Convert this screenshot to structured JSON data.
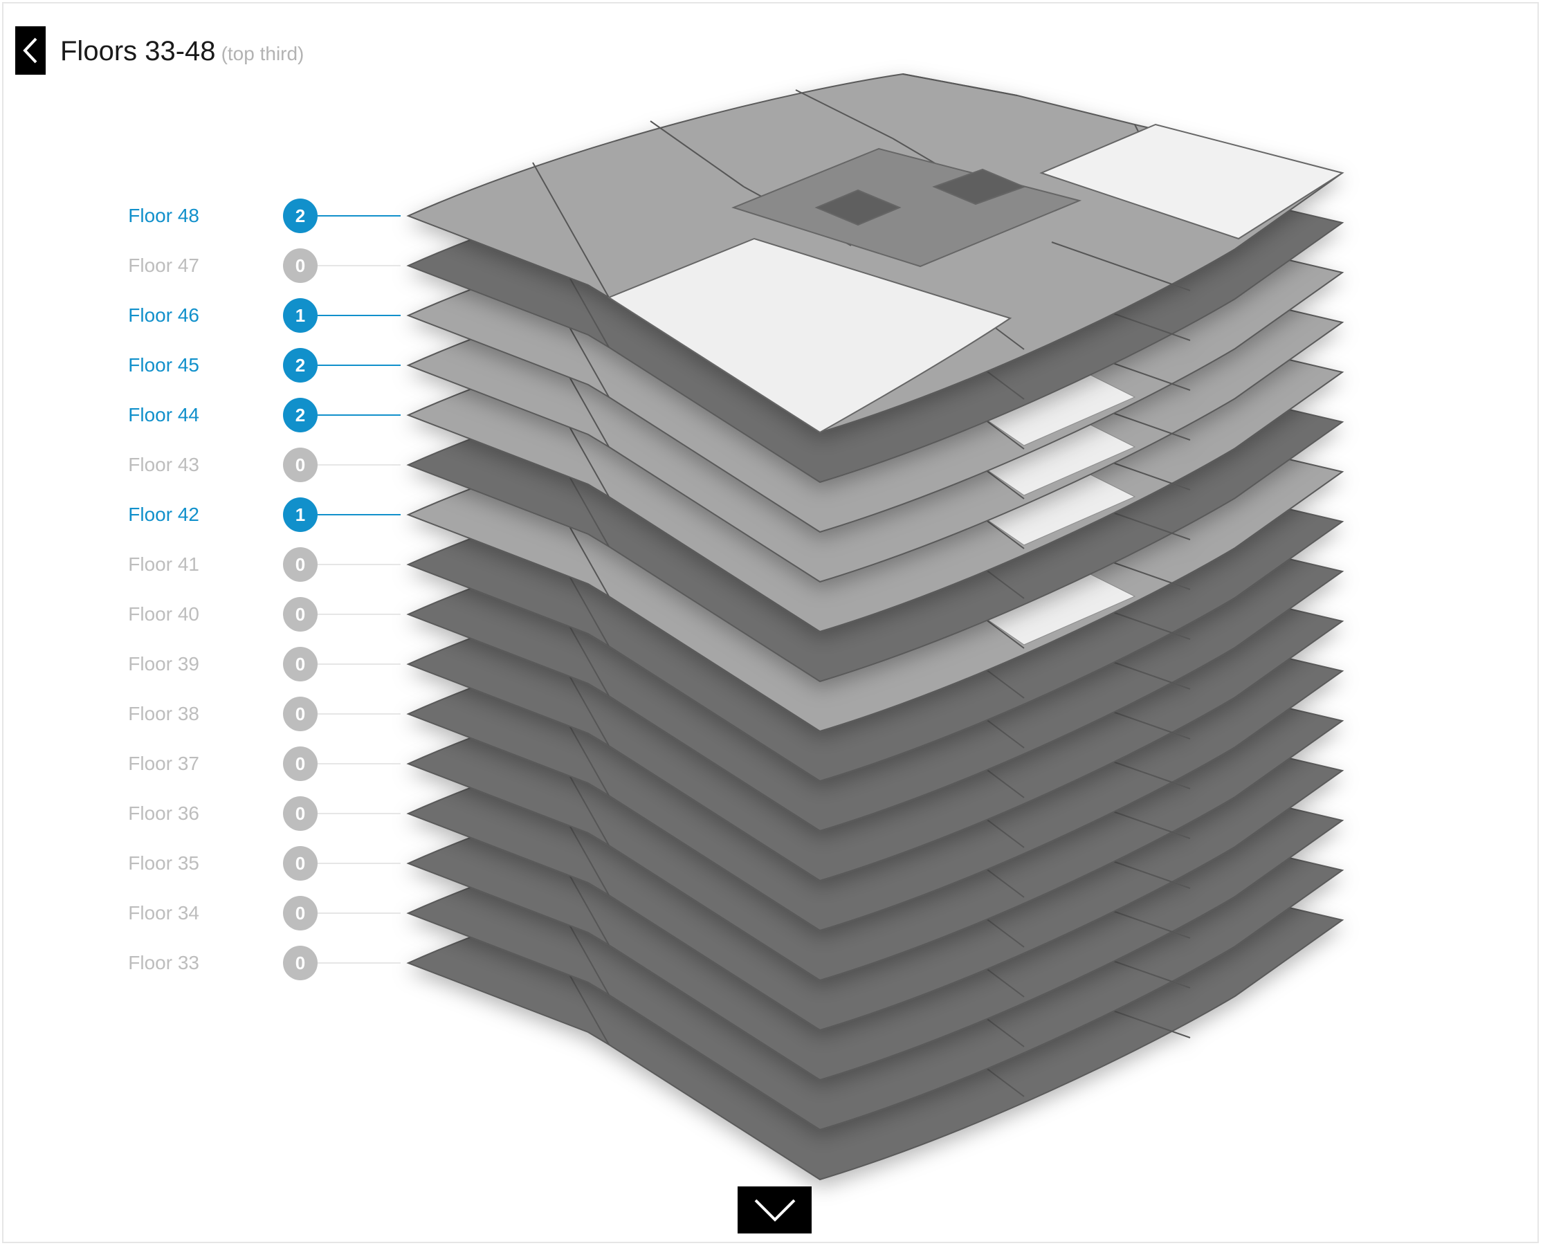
{
  "header": {
    "title": "Floors 33-48",
    "subtitle": "(top third)"
  },
  "icons": {
    "back": "chevron-left-icon",
    "down": "chevron-down-icon"
  },
  "colors": {
    "active": "#1190cb",
    "inactive": "#bdbdbd",
    "slab_empty": "#6e6e6e",
    "slab_partial": "#a6a6a6",
    "slab_highlight": "#eeeeee"
  },
  "floors": [
    {
      "label": "Floor 48",
      "count": "2",
      "active": true
    },
    {
      "label": "Floor 47",
      "count": "0",
      "active": false
    },
    {
      "label": "Floor 46",
      "count": "1",
      "active": true
    },
    {
      "label": "Floor 45",
      "count": "2",
      "active": true
    },
    {
      "label": "Floor 44",
      "count": "2",
      "active": true
    },
    {
      "label": "Floor 43",
      "count": "0",
      "active": false
    },
    {
      "label": "Floor 42",
      "count": "1",
      "active": true
    },
    {
      "label": "Floor 41",
      "count": "0",
      "active": false
    },
    {
      "label": "Floor 40",
      "count": "0",
      "active": false
    },
    {
      "label": "Floor 39",
      "count": "0",
      "active": false
    },
    {
      "label": "Floor 38",
      "count": "0",
      "active": false
    },
    {
      "label": "Floor 37",
      "count": "0",
      "active": false
    },
    {
      "label": "Floor 36",
      "count": "0",
      "active": false
    },
    {
      "label": "Floor 35",
      "count": "0",
      "active": false
    },
    {
      "label": "Floor 34",
      "count": "0",
      "active": false
    },
    {
      "label": "Floor 33",
      "count": "0",
      "active": false
    }
  ]
}
